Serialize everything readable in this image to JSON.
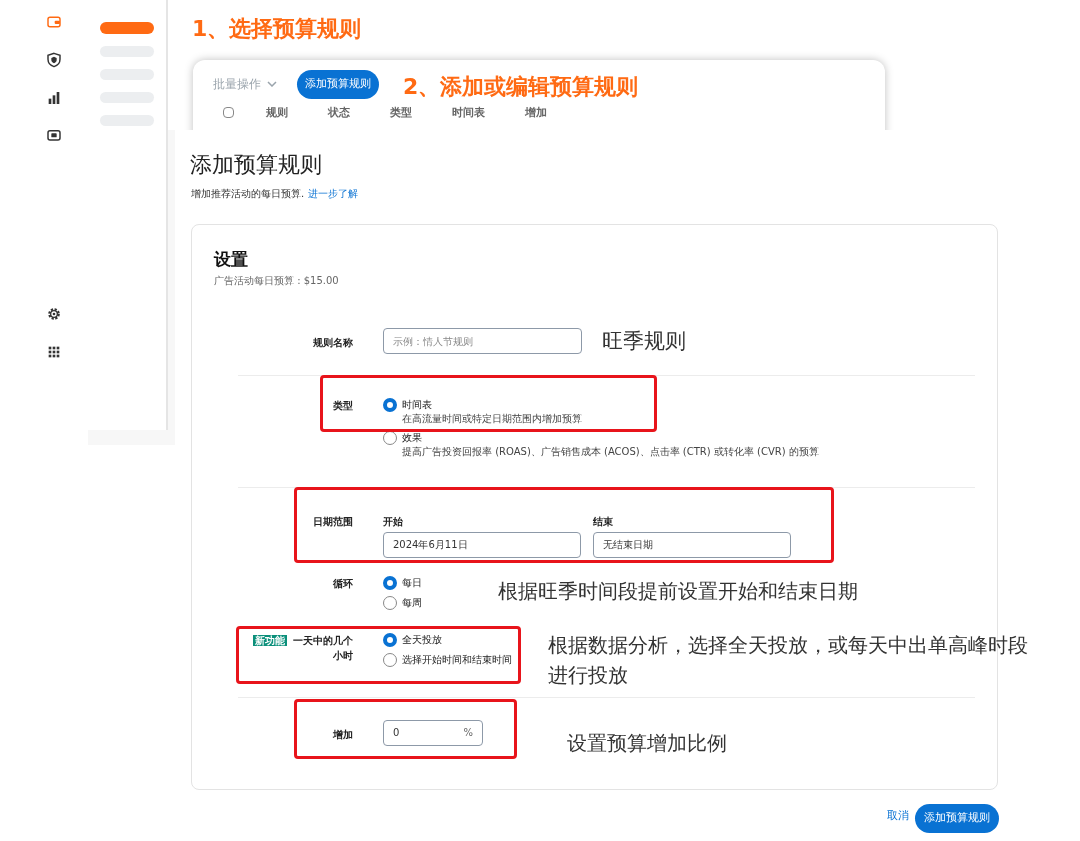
{
  "background_app": {
    "sidebar_icons": [
      {
        "kind": "wallet",
        "selected": true
      },
      {
        "kind": "shield",
        "selected": false
      },
      {
        "kind": "chart",
        "selected": false
      },
      {
        "kind": "screen",
        "selected": false
      },
      {
        "kind": "gear",
        "selected": false
      },
      {
        "kind": "grid",
        "selected": false
      }
    ],
    "nav_items": [
      {
        "selected": true
      },
      {
        "selected": false
      },
      {
        "selected": false
      },
      {
        "selected": false
      },
      {
        "selected": false
      }
    ],
    "toolbar": {
      "bulk_action": "批量操作",
      "add_button": "添加预算规则"
    },
    "select_all": {
      "checked": false
    },
    "table_columns": [
      "规则",
      "状态",
      "类型",
      "时间表",
      "增加"
    ]
  },
  "form": {
    "title": "添加预算规则",
    "subtitle": "增加推荐活动的每日预算.",
    "learn_more": "进一步了解",
    "settings": {
      "title": "设置",
      "budget": "广告活动每日预算 : $15.00"
    },
    "rule_name": {
      "label": "规则名称",
      "placeholder": "示例：情人节规则"
    },
    "type": {
      "label": "类型",
      "options": [
        {
          "label": "时间表",
          "description": "在高流量时间或特定日期范围内增加预算",
          "selected": true
        },
        {
          "label": "效果",
          "description": "提高广告投资回报率 (ROAS)、广告销售成本 (ACOS)、点击率 (CTR) 或转化率 (CVR) 的预算",
          "selected": false
        }
      ]
    },
    "date_range": {
      "label": "日期范围",
      "start": {
        "label": "开始",
        "value": "2024年6月11日"
      },
      "end": {
        "label": "结束",
        "value": "无结束日期"
      }
    },
    "recurrence": {
      "label": "循环",
      "options": [
        {
          "label": "每日",
          "selected": true
        },
        {
          "label": "每周",
          "selected": false
        }
      ]
    },
    "hours": {
      "badge": "新功能",
      "label": "一天中的几个小时",
      "options": [
        {
          "label": "全天投放",
          "selected": true
        },
        {
          "label": "选择开始时间和结束时间",
          "selected": false
        }
      ]
    },
    "increase": {
      "label": "增加",
      "value": "0",
      "unit": "%"
    },
    "buttons": {
      "cancel": "取消",
      "submit": "添加预算规则"
    }
  },
  "annotations": {
    "steps": [
      "1、选择预算规则",
      "2、添加或编辑预算规则"
    ],
    "notes": [
      "旺季规则",
      "根据旺季时间段提前设置开始和结束日期",
      "根据数据分析，选择全天投放，或每天中出单高峰时段进行投放",
      "设置预算增加比例"
    ]
  }
}
